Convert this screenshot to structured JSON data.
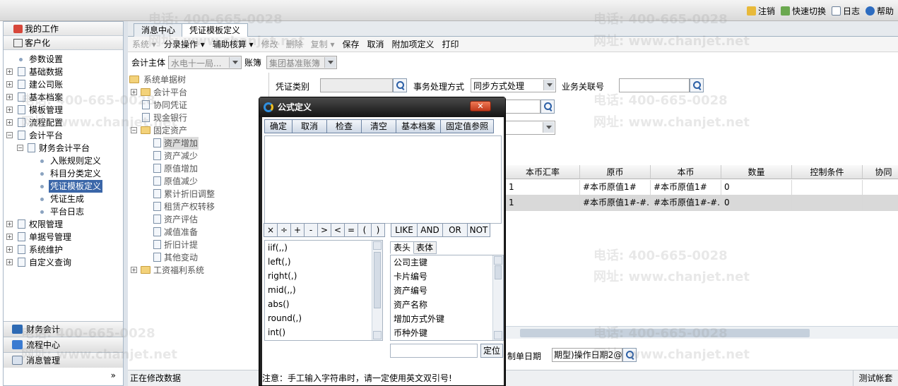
{
  "top_links": [
    {
      "label": "注销",
      "icon": "key-icon"
    },
    {
      "label": "快速切换",
      "icon": "switch-icon"
    },
    {
      "label": "日志",
      "icon": "log-icon"
    },
    {
      "label": "帮助",
      "icon": "help-icon"
    }
  ],
  "sidebar": {
    "my_work": "我的工作",
    "customize": "客户化",
    "tree": [
      {
        "label": "参数设置"
      },
      {
        "label": "基础数据"
      },
      {
        "label": "建公司账"
      },
      {
        "label": "基本档案"
      },
      {
        "label": "模板管理"
      },
      {
        "label": "流程配置"
      },
      {
        "label": "会计平台"
      },
      {
        "label": "财务会计平台"
      },
      {
        "label": "入账规则定义"
      },
      {
        "label": "科目分类定义"
      },
      {
        "label": "凭证模板定义"
      },
      {
        "label": "凭证生成"
      },
      {
        "label": "平台日志"
      },
      {
        "label": "权限管理"
      },
      {
        "label": "单据号管理"
      },
      {
        "label": "系统维护"
      },
      {
        "label": "自定义查询"
      }
    ],
    "bottom": [
      {
        "label": "财务会计"
      },
      {
        "label": "流程中心"
      },
      {
        "label": "消息管理"
      }
    ],
    "collapse_glyph": "»"
  },
  "tabs": [
    {
      "label": "消息中心"
    },
    {
      "label": "凭证模板定义"
    }
  ],
  "toolbar": {
    "system": "系统",
    "split": "分录操作",
    "aux": "辅助核算",
    "modify": "修改",
    "delete": "删除",
    "copy": "复制",
    "save": "保存",
    "cancel": "取消",
    "attach": "附加项定义",
    "print": "打印"
  },
  "filter": {
    "entity_label": "会计主体",
    "entity_value": "水电十一局...",
    "book_label": "账簿",
    "book_value": "集团基准账簿"
  },
  "tree2": [
    {
      "label": "系统单据树"
    },
    {
      "label": "会计平台"
    },
    {
      "label": "协同凭证"
    },
    {
      "label": "现金银行"
    },
    {
      "label": "固定资产"
    },
    {
      "label": "资产增加"
    },
    {
      "label": "资产减少"
    },
    {
      "label": "原值增加"
    },
    {
      "label": "原值减少"
    },
    {
      "label": "累计折旧调整"
    },
    {
      "label": "租赁产权转移"
    },
    {
      "label": "资产评估"
    },
    {
      "label": "减值准备"
    },
    {
      "label": "折旧计提"
    },
    {
      "label": "其他变动"
    },
    {
      "label": "工资福利系统"
    }
  ],
  "form": {
    "voucher_type_label": "凭证类别",
    "mode_label": "事务处理方式",
    "mode_value": "同步方式处理",
    "relate_label": "业务关联号",
    "date_label": "制单日期",
    "date_value": "期型)操作日期2@"
  },
  "grid": {
    "headers": [
      "本币汇率",
      "原币",
      "本币",
      "数量",
      "控制条件",
      "协同"
    ],
    "rows": [
      [
        "1",
        "#本币原值1#",
        "#本币原值1#",
        "0",
        "",
        ""
      ],
      [
        "1",
        "#本币原值1#-#...",
        "#本币原值1#-#...",
        "0",
        "",
        ""
      ]
    ]
  },
  "status": {
    "text": "正在修改数据",
    "account": "测试帐套"
  },
  "dialog": {
    "title": "公式定义",
    "close": "✕",
    "buttons": [
      "确定",
      "取消",
      "检查",
      "清空",
      "基本档案",
      "固定值参照"
    ],
    "ops": [
      "×",
      "÷",
      "+",
      "-",
      ">",
      "<",
      "=",
      "(",
      ")",
      "LIKE",
      "AND",
      "OR",
      "NOT"
    ],
    "functions": [
      "iif(,,)",
      "left(,)",
      "right(,)",
      "mid(,,)",
      "abs()",
      "round(,)",
      "int()"
    ],
    "field_tabs": [
      "表头",
      "表体"
    ],
    "fields": [
      "公司主键",
      "卡片编号",
      "资产编号",
      "资产名称",
      "增加方式外键",
      "币种外键"
    ],
    "locate": "定位",
    "note": "注意：手工输入字符串时，请一定使用英文双引号!"
  },
  "watermark": {
    "phone": "电话: 400-665-0028",
    "site": "网址: www.chanjet.net"
  },
  "colors": {
    "selected": "#3a66a8",
    "dialog_frame": "#1f1f1f",
    "close_button": "#d2502d"
  }
}
